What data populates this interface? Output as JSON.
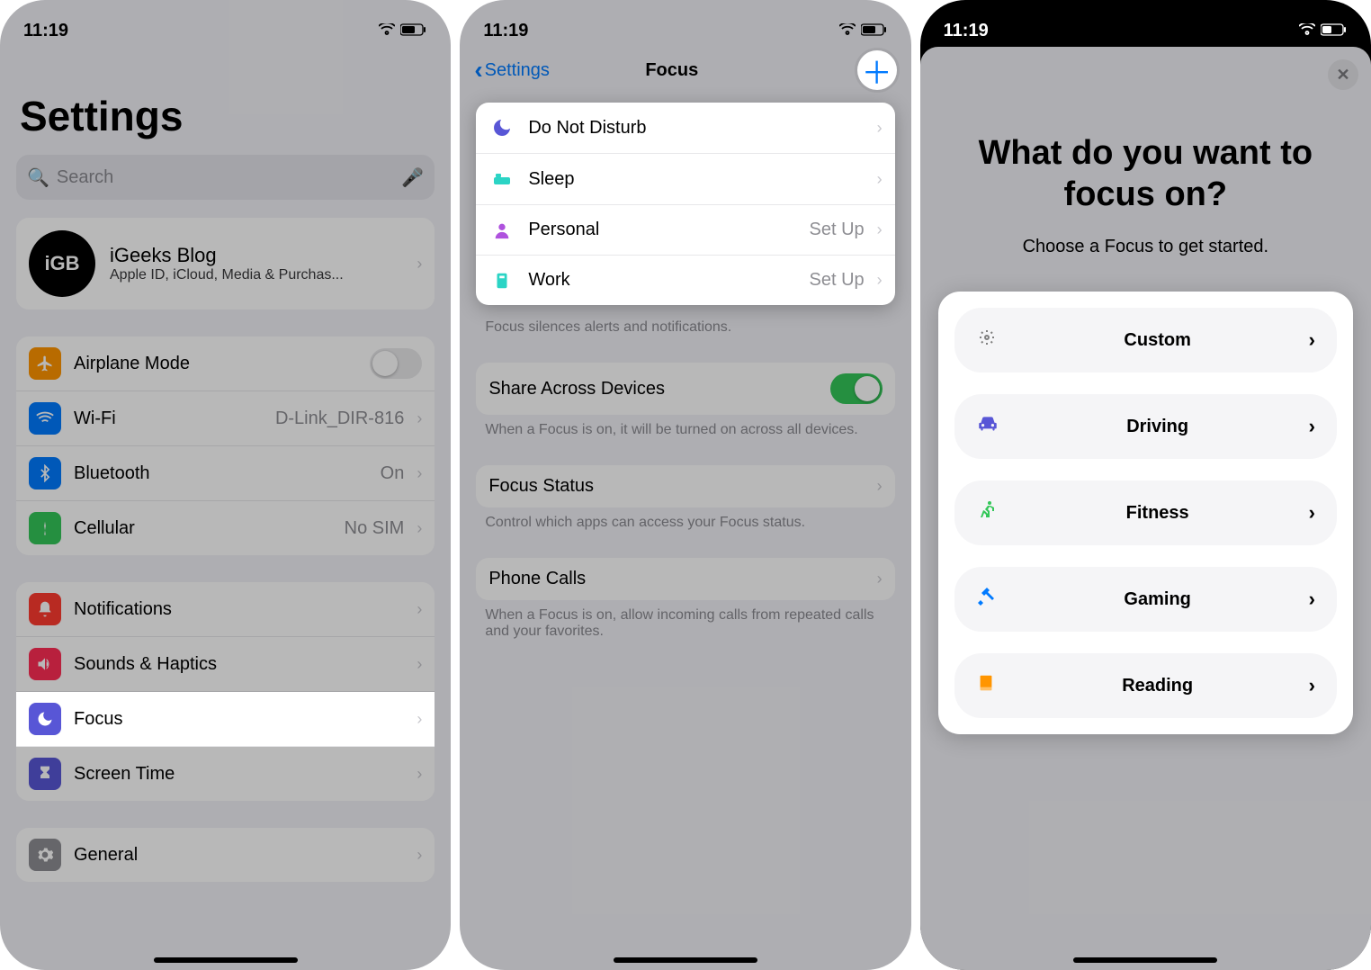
{
  "time": "11:19",
  "phone1": {
    "title": "Settings",
    "search_placeholder": "Search",
    "apple_id": {
      "avatar": "iGB",
      "name": "iGeeks Blog",
      "sub": "Apple ID, iCloud, Media & Purchas..."
    },
    "group_net": [
      {
        "icon_bg": "#ff9500",
        "icon": "airplane",
        "label": "Airplane Mode",
        "toggle": true
      },
      {
        "icon_bg": "#007aff",
        "icon": "wifi",
        "label": "Wi-Fi",
        "value": "D-Link_DIR-816"
      },
      {
        "icon_bg": "#007aff",
        "icon": "bluetooth",
        "label": "Bluetooth",
        "value": "On"
      },
      {
        "icon_bg": "#34c759",
        "icon": "cellular",
        "label": "Cellular",
        "value": "No SIM"
      }
    ],
    "group_notif": [
      {
        "icon_bg": "#ff3b30",
        "icon": "bell",
        "label": "Notifications"
      },
      {
        "icon_bg": "#ff2d55",
        "icon": "speaker",
        "label": "Sounds & Haptics"
      },
      {
        "icon_bg": "#5856d6",
        "icon": "moon",
        "label": "Focus",
        "highlight": true
      },
      {
        "icon_bg": "#5856d6",
        "icon": "hourglass",
        "label": "Screen Time"
      }
    ],
    "group_general": [
      {
        "icon_bg": "#8e8e93",
        "icon": "gear",
        "label": "General"
      }
    ]
  },
  "phone2": {
    "back": "Settings",
    "title": "Focus",
    "list": [
      {
        "icon": "🌙",
        "color": "#5856d6",
        "label": "Do Not Disturb"
      },
      {
        "icon": "🛏",
        "color": "#2bd4c5",
        "label": "Sleep"
      },
      {
        "icon": "👤",
        "color": "#af52de",
        "label": "Personal",
        "value": "Set Up"
      },
      {
        "icon": "🏷",
        "color": "#2bd4c5",
        "label": "Work",
        "value": "Set Up"
      }
    ],
    "footer1": "Focus silences alerts and notifications.",
    "share_label": "Share Across Devices",
    "share_footer": "When a Focus is on, it will be turned on across all devices.",
    "status_label": "Focus Status",
    "status_footer": "Control which apps can access your Focus status.",
    "calls_label": "Phone Calls",
    "calls_footer": "When a Focus is on, allow incoming calls from repeated calls and your favorites."
  },
  "phone3": {
    "title": "What do you want to focus on?",
    "subtitle": "Choose a Focus to get started.",
    "options": [
      {
        "name": "custom",
        "label": "Custom",
        "color": "#808080"
      },
      {
        "name": "driving",
        "label": "Driving",
        "color": "#5856d6"
      },
      {
        "name": "fitness",
        "label": "Fitness",
        "color": "#34c759"
      },
      {
        "name": "gaming",
        "label": "Gaming",
        "color": "#007aff"
      },
      {
        "name": "reading",
        "label": "Reading",
        "color": "#ff9500"
      }
    ]
  }
}
